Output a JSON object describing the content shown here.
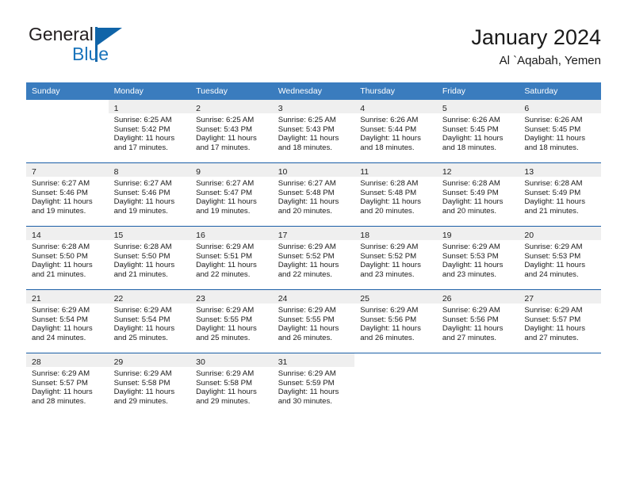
{
  "brand": {
    "word1": "General",
    "word2": "Blue",
    "accent_color": "#1064a8"
  },
  "header": {
    "title": "January 2024",
    "subtitle": "Al `Aqabah, Yemen"
  },
  "colors": {
    "header_row_bg": "#3a7cbe",
    "header_row_text": "#ffffff",
    "daynum_band_bg": "#efefef",
    "week_separator": "#1b5fa7"
  },
  "weekday_headers": [
    "Sunday",
    "Monday",
    "Tuesday",
    "Wednesday",
    "Thursday",
    "Friday",
    "Saturday"
  ],
  "weeks": [
    [
      {
        "day": "",
        "sunrise": "",
        "sunset": "",
        "daylight_1": "",
        "daylight_2": "",
        "empty": true
      },
      {
        "day": "1",
        "sunrise": "Sunrise: 6:25 AM",
        "sunset": "Sunset: 5:42 PM",
        "daylight_1": "Daylight: 11 hours",
        "daylight_2": "and 17 minutes."
      },
      {
        "day": "2",
        "sunrise": "Sunrise: 6:25 AM",
        "sunset": "Sunset: 5:43 PM",
        "daylight_1": "Daylight: 11 hours",
        "daylight_2": "and 17 minutes."
      },
      {
        "day": "3",
        "sunrise": "Sunrise: 6:25 AM",
        "sunset": "Sunset: 5:43 PM",
        "daylight_1": "Daylight: 11 hours",
        "daylight_2": "and 18 minutes."
      },
      {
        "day": "4",
        "sunrise": "Sunrise: 6:26 AM",
        "sunset": "Sunset: 5:44 PM",
        "daylight_1": "Daylight: 11 hours",
        "daylight_2": "and 18 minutes."
      },
      {
        "day": "5",
        "sunrise": "Sunrise: 6:26 AM",
        "sunset": "Sunset: 5:45 PM",
        "daylight_1": "Daylight: 11 hours",
        "daylight_2": "and 18 minutes."
      },
      {
        "day": "6",
        "sunrise": "Sunrise: 6:26 AM",
        "sunset": "Sunset: 5:45 PM",
        "daylight_1": "Daylight: 11 hours",
        "daylight_2": "and 18 minutes."
      }
    ],
    [
      {
        "day": "7",
        "sunrise": "Sunrise: 6:27 AM",
        "sunset": "Sunset: 5:46 PM",
        "daylight_1": "Daylight: 11 hours",
        "daylight_2": "and 19 minutes."
      },
      {
        "day": "8",
        "sunrise": "Sunrise: 6:27 AM",
        "sunset": "Sunset: 5:46 PM",
        "daylight_1": "Daylight: 11 hours",
        "daylight_2": "and 19 minutes."
      },
      {
        "day": "9",
        "sunrise": "Sunrise: 6:27 AM",
        "sunset": "Sunset: 5:47 PM",
        "daylight_1": "Daylight: 11 hours",
        "daylight_2": "and 19 minutes."
      },
      {
        "day": "10",
        "sunrise": "Sunrise: 6:27 AM",
        "sunset": "Sunset: 5:48 PM",
        "daylight_1": "Daylight: 11 hours",
        "daylight_2": "and 20 minutes."
      },
      {
        "day": "11",
        "sunrise": "Sunrise: 6:28 AM",
        "sunset": "Sunset: 5:48 PM",
        "daylight_1": "Daylight: 11 hours",
        "daylight_2": "and 20 minutes."
      },
      {
        "day": "12",
        "sunrise": "Sunrise: 6:28 AM",
        "sunset": "Sunset: 5:49 PM",
        "daylight_1": "Daylight: 11 hours",
        "daylight_2": "and 20 minutes."
      },
      {
        "day": "13",
        "sunrise": "Sunrise: 6:28 AM",
        "sunset": "Sunset: 5:49 PM",
        "daylight_1": "Daylight: 11 hours",
        "daylight_2": "and 21 minutes."
      }
    ],
    [
      {
        "day": "14",
        "sunrise": "Sunrise: 6:28 AM",
        "sunset": "Sunset: 5:50 PM",
        "daylight_1": "Daylight: 11 hours",
        "daylight_2": "and 21 minutes."
      },
      {
        "day": "15",
        "sunrise": "Sunrise: 6:28 AM",
        "sunset": "Sunset: 5:50 PM",
        "daylight_1": "Daylight: 11 hours",
        "daylight_2": "and 21 minutes."
      },
      {
        "day": "16",
        "sunrise": "Sunrise: 6:29 AM",
        "sunset": "Sunset: 5:51 PM",
        "daylight_1": "Daylight: 11 hours",
        "daylight_2": "and 22 minutes."
      },
      {
        "day": "17",
        "sunrise": "Sunrise: 6:29 AM",
        "sunset": "Sunset: 5:52 PM",
        "daylight_1": "Daylight: 11 hours",
        "daylight_2": "and 22 minutes."
      },
      {
        "day": "18",
        "sunrise": "Sunrise: 6:29 AM",
        "sunset": "Sunset: 5:52 PM",
        "daylight_1": "Daylight: 11 hours",
        "daylight_2": "and 23 minutes."
      },
      {
        "day": "19",
        "sunrise": "Sunrise: 6:29 AM",
        "sunset": "Sunset: 5:53 PM",
        "daylight_1": "Daylight: 11 hours",
        "daylight_2": "and 23 minutes."
      },
      {
        "day": "20",
        "sunrise": "Sunrise: 6:29 AM",
        "sunset": "Sunset: 5:53 PM",
        "daylight_1": "Daylight: 11 hours",
        "daylight_2": "and 24 minutes."
      }
    ],
    [
      {
        "day": "21",
        "sunrise": "Sunrise: 6:29 AM",
        "sunset": "Sunset: 5:54 PM",
        "daylight_1": "Daylight: 11 hours",
        "daylight_2": "and 24 minutes."
      },
      {
        "day": "22",
        "sunrise": "Sunrise: 6:29 AM",
        "sunset": "Sunset: 5:54 PM",
        "daylight_1": "Daylight: 11 hours",
        "daylight_2": "and 25 minutes."
      },
      {
        "day": "23",
        "sunrise": "Sunrise: 6:29 AM",
        "sunset": "Sunset: 5:55 PM",
        "daylight_1": "Daylight: 11 hours",
        "daylight_2": "and 25 minutes."
      },
      {
        "day": "24",
        "sunrise": "Sunrise: 6:29 AM",
        "sunset": "Sunset: 5:55 PM",
        "daylight_1": "Daylight: 11 hours",
        "daylight_2": "and 26 minutes."
      },
      {
        "day": "25",
        "sunrise": "Sunrise: 6:29 AM",
        "sunset": "Sunset: 5:56 PM",
        "daylight_1": "Daylight: 11 hours",
        "daylight_2": "and 26 minutes."
      },
      {
        "day": "26",
        "sunrise": "Sunrise: 6:29 AM",
        "sunset": "Sunset: 5:56 PM",
        "daylight_1": "Daylight: 11 hours",
        "daylight_2": "and 27 minutes."
      },
      {
        "day": "27",
        "sunrise": "Sunrise: 6:29 AM",
        "sunset": "Sunset: 5:57 PM",
        "daylight_1": "Daylight: 11 hours",
        "daylight_2": "and 27 minutes."
      }
    ],
    [
      {
        "day": "28",
        "sunrise": "Sunrise: 6:29 AM",
        "sunset": "Sunset: 5:57 PM",
        "daylight_1": "Daylight: 11 hours",
        "daylight_2": "and 28 minutes."
      },
      {
        "day": "29",
        "sunrise": "Sunrise: 6:29 AM",
        "sunset": "Sunset: 5:58 PM",
        "daylight_1": "Daylight: 11 hours",
        "daylight_2": "and 29 minutes."
      },
      {
        "day": "30",
        "sunrise": "Sunrise: 6:29 AM",
        "sunset": "Sunset: 5:58 PM",
        "daylight_1": "Daylight: 11 hours",
        "daylight_2": "and 29 minutes."
      },
      {
        "day": "31",
        "sunrise": "Sunrise: 6:29 AM",
        "sunset": "Sunset: 5:59 PM",
        "daylight_1": "Daylight: 11 hours",
        "daylight_2": "and 30 minutes."
      },
      {
        "day": "",
        "sunrise": "",
        "sunset": "",
        "daylight_1": "",
        "daylight_2": "",
        "empty": true
      },
      {
        "day": "",
        "sunrise": "",
        "sunset": "",
        "daylight_1": "",
        "daylight_2": "",
        "empty": true
      },
      {
        "day": "",
        "sunrise": "",
        "sunset": "",
        "daylight_1": "",
        "daylight_2": "",
        "empty": true
      }
    ]
  ]
}
